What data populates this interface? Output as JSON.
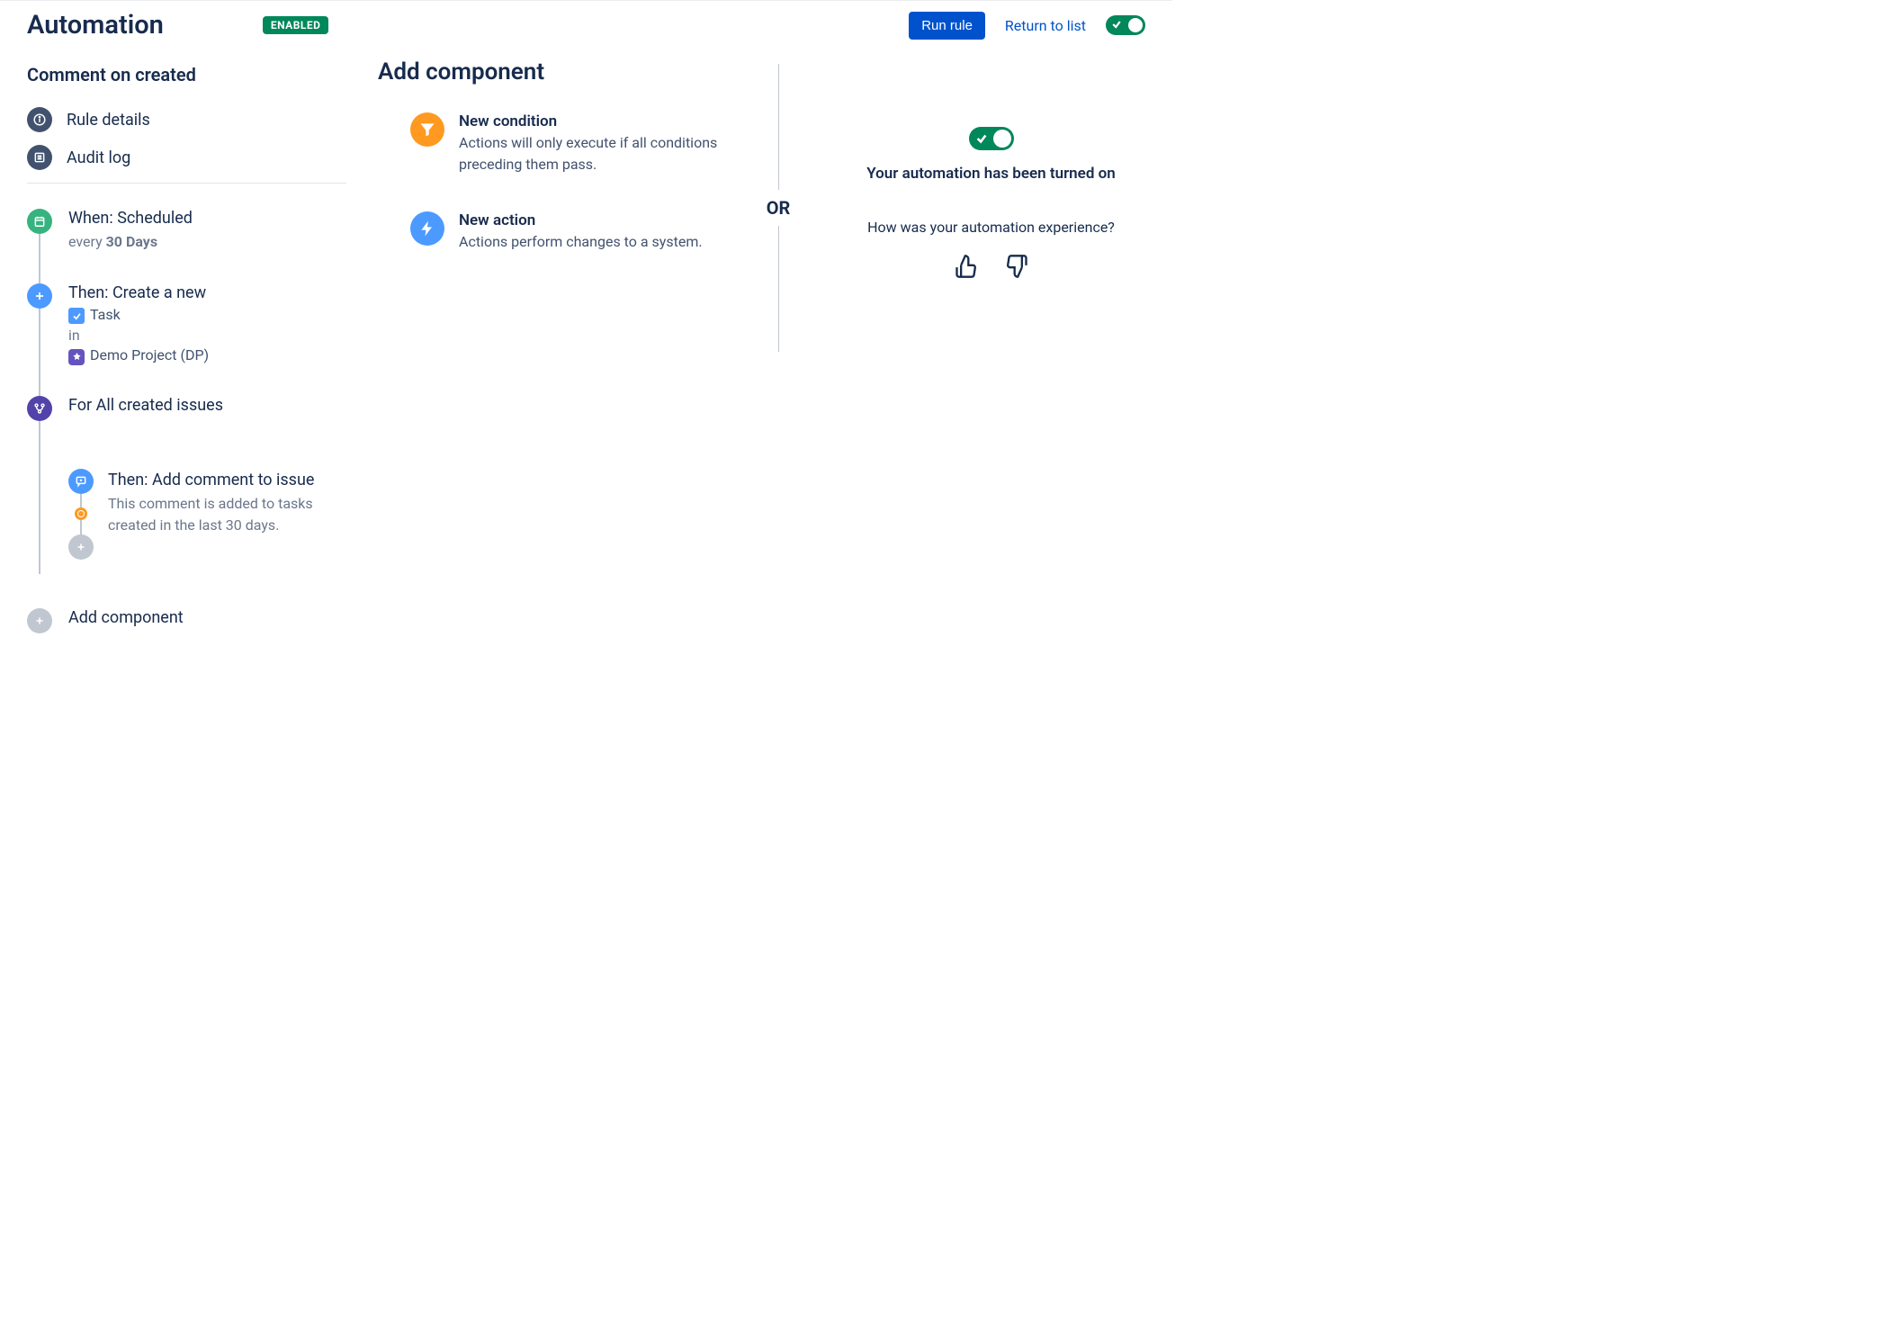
{
  "header": {
    "title": "Automation",
    "badge": "ENABLED",
    "run_rule": "Run rule",
    "return_to_list": "Return to list"
  },
  "sidebar": {
    "rule_name": "Comment on created",
    "rule_details": "Rule details",
    "audit_log": "Audit log"
  },
  "timeline": {
    "trigger": {
      "title": "When: Scheduled",
      "sub_prefix": "every ",
      "sub_bold": "30 Days"
    },
    "action_create": {
      "title": "Then: Create a new",
      "task_label": "Task",
      "in_label": "in",
      "project_label": "Demo Project (DP)"
    },
    "branch": {
      "title": "For All created issues",
      "child": {
        "title": "Then: Add comment to issue",
        "desc": "This comment is added to tasks created in the last 30 days."
      }
    },
    "add_component": "Add component"
  },
  "add_panel": {
    "heading": "Add component",
    "condition": {
      "title": "New condition",
      "desc": "Actions will only execute if all conditions preceding them pass."
    },
    "action": {
      "title": "New action",
      "desc": "Actions perform changes to a system."
    }
  },
  "separator": {
    "or": "OR"
  },
  "feedback": {
    "turned_on": "Your automation has been turned on",
    "question": "How was your automation experience?"
  }
}
